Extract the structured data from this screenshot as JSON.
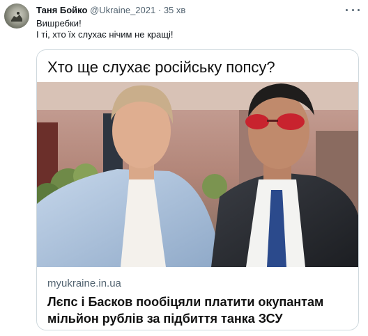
{
  "tweet": {
    "author_name": "Таня Бойко",
    "author_handle": "@Ukraine_2021",
    "separator": "·",
    "time": "35 хв",
    "text_lines": [
      "Вишребки!",
      "І ті, хто їх слухає нічим не кращі!"
    ]
  },
  "card": {
    "headline": "Хто ще слухає російську попсу?",
    "domain": "myukraine.in.ua",
    "title_lines": [
      "Лєпс і Басков пообіцяли платити окупантам",
      "мільйон рублів за підбиття танка ЗСУ"
    ]
  },
  "icons": {
    "more": "more-horizontal-icon"
  }
}
